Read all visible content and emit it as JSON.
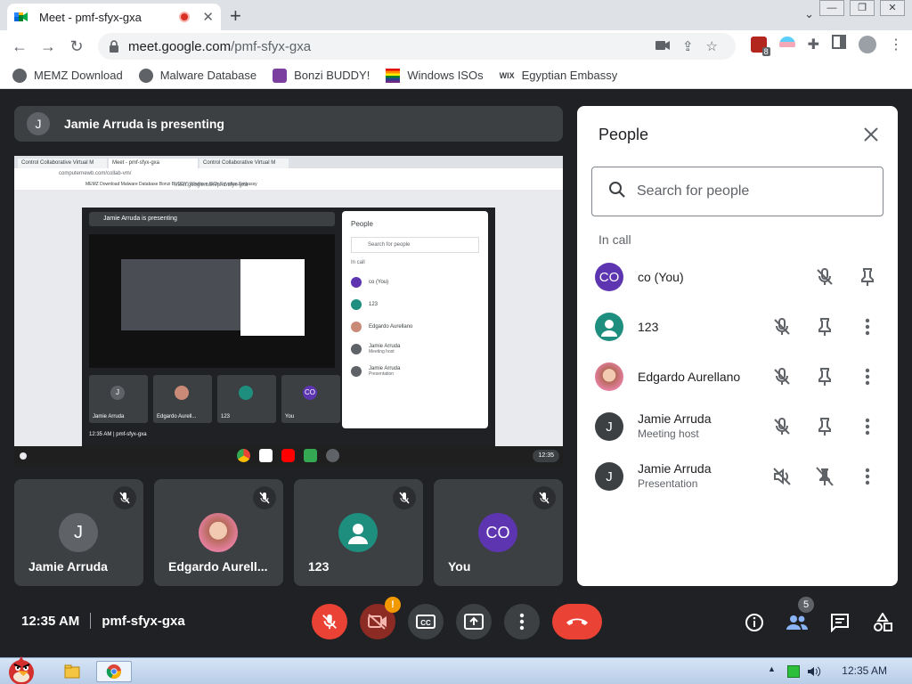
{
  "browser": {
    "tab_title": "Meet - pmf-sfyx-gxa",
    "url_host": "meet.google.com",
    "url_path": "/pmf-sfyx-gxa",
    "extension_badge": "8",
    "bookmarks": [
      "MEMZ Download",
      "Malware Database",
      "Bonzi BUDDY!",
      "Windows ISOs",
      "Egyptian Embassy"
    ]
  },
  "meet": {
    "presenting_avatar": "J",
    "presenting_text": "Jamie Arruda is presenting",
    "shared_screen": {
      "tabs": [
        "Control Collaborative Virtual M",
        "Meet - pmf-sfyx-gxa",
        "Control Collaborative Virtual M"
      ],
      "url": "computernewb.com/collab-vm/",
      "inner_url": "meet.google.com/pmf-sfyx-gxa",
      "bookmarks": "MEMZ Download   Malware Database   Bonzi BUDDY!   Windows ISOs   Egyptian Embassy",
      "presenting": "Jamie Arruda is presenting",
      "tiles": [
        "Jamie Arruda",
        "Edgardo Aurell...",
        "123",
        "You"
      ],
      "tile_avatars": [
        "J",
        "",
        "",
        "CO"
      ],
      "people_title": "People",
      "search": "Search for people",
      "in_call": "In call",
      "rows": [
        "co (You)",
        "123",
        "Edgardo Aurellano",
        "Jamie Arruda",
        "Jamie Arruda"
      ],
      "rows_sub": [
        "",
        "",
        "",
        "Meeting host",
        "Presentation"
      ],
      "bottom": "12:35 AM  |  pmf-sfyx-gxa",
      "shelf_time": "12:35"
    },
    "tiles": [
      {
        "name": "Jamie Arruda",
        "avatar": "J"
      },
      {
        "name": "Edgardo Aurell...",
        "avatar": ""
      },
      {
        "name": "123",
        "avatar": ""
      },
      {
        "name": "You",
        "avatar": "CO"
      }
    ],
    "people": {
      "title": "People",
      "search_placeholder": "Search for people",
      "section": "In call",
      "list": [
        {
          "name": "co (You)",
          "sub": "",
          "avatar": "CO"
        },
        {
          "name": "123",
          "sub": "",
          "avatar": ""
        },
        {
          "name": "Edgardo Aurellano",
          "sub": "",
          "avatar": ""
        },
        {
          "name": "Jamie Arruda",
          "sub": "Meeting host",
          "avatar": "J"
        },
        {
          "name": "Jamie Arruda",
          "sub": "Presentation",
          "avatar": "J"
        }
      ]
    },
    "time": "12:35 AM",
    "meeting_code": "pmf-sfyx-gxa",
    "camera_warning": "!",
    "people_count": "5"
  },
  "taskbar": {
    "clock": "12:35 AM"
  },
  "colors": {
    "meet_bg": "#202124",
    "tile_bg": "#3c4043",
    "red": "#ea4335",
    "co_avatar": "#5e35b1",
    "teal_avatar": "#1e8e7e"
  }
}
